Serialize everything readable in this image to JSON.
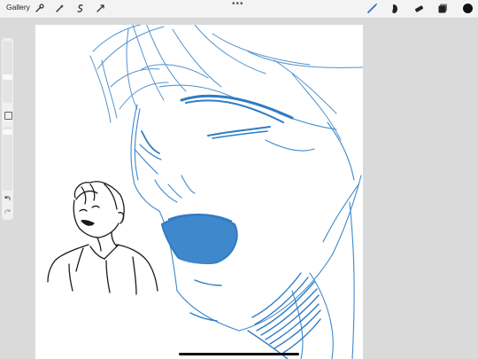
{
  "topbar": {
    "gallery_label": "Gallery",
    "left_icons": [
      "actions-icon",
      "adjustments-icon",
      "selection-icon",
      "transform-icon"
    ],
    "right_icons": [
      "brush-icon",
      "smudge-icon",
      "eraser-icon",
      "layers-icon",
      "color-icon"
    ],
    "active_color": "#2b6fc7",
    "current_color": "#111111"
  },
  "sidebar": {
    "icons": [
      "brush-size-slider",
      "modify-button",
      "opacity-slider",
      "undo-icon",
      "redo-icon"
    ]
  },
  "colors": {
    "sketch_blue": "#3f88cc",
    "ink": "#1a1a1a"
  }
}
